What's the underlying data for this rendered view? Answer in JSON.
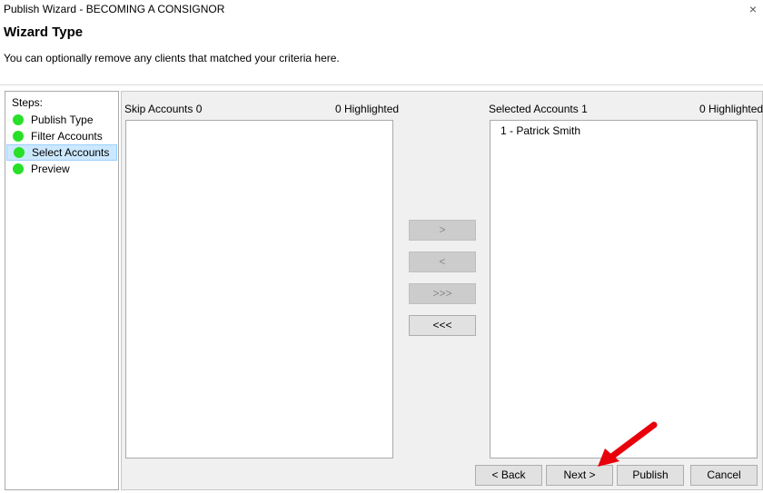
{
  "window": {
    "title": "Publish Wizard - BECOMING A CONSIGNOR",
    "close_glyph": "×"
  },
  "header": {
    "heading": "Wizard Type",
    "description": "You can optionally remove any clients that matched your criteria here."
  },
  "steps": {
    "label": "Steps:",
    "items": [
      {
        "label": "Publish Type",
        "status_color": "#27e027"
      },
      {
        "label": "Filter Accounts",
        "status_color": "#27e027"
      },
      {
        "label": "Select Accounts",
        "status_color": "#27e027",
        "selected": true
      },
      {
        "label": "Preview",
        "status_color": "#27e027"
      }
    ]
  },
  "skip_accounts": {
    "caption": "Skip Accounts 0",
    "highlighted": "0 Highlighted",
    "items": []
  },
  "selected_accounts": {
    "caption": "Selected Accounts 1",
    "highlighted": "0 Highlighted",
    "items": [
      "1 - Patrick Smith"
    ]
  },
  "move_buttons": {
    "move_right": ">",
    "move_left": "<",
    "move_all_right": ">>>",
    "move_all_left": "<<<"
  },
  "footer": {
    "back": "< Back",
    "next": "Next >",
    "publish": "Publish",
    "cancel": "Cancel"
  },
  "colors": {
    "annotation_arrow": "#e8000b",
    "selection_bg": "#cce8ff",
    "status_ok": "#27e027"
  }
}
